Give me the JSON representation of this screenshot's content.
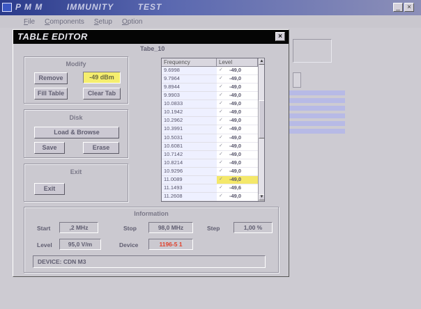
{
  "app": {
    "title": "P M M        IMMUNITY        TEST"
  },
  "menu": [
    "File",
    "Components",
    "Setup",
    "Option"
  ],
  "dialog": {
    "title": "TABLE EDITOR",
    "close": "×"
  },
  "modify": {
    "label": "Modify",
    "remove": "Remove",
    "value": "-49 dBm",
    "fill_table": "Fill Table",
    "clear_tab": "Clear Tab"
  },
  "disk": {
    "label": "Disk",
    "load_browse": "Load & Browse",
    "save": "Save",
    "erase": "Erase"
  },
  "exit": {
    "label": "Exit",
    "exit_btn": "Exit"
  },
  "table": {
    "label": "Tabe_10",
    "columns": [
      "Frequency",
      "Level"
    ],
    "selected_index": 13,
    "rows": [
      {
        "f": "9.6998",
        "l": "-49,0"
      },
      {
        "f": "9.7964",
        "l": "-49,0"
      },
      {
        "f": "9.8944",
        "l": "-49,0"
      },
      {
        "f": "9.9903",
        "l": "-49,0"
      },
      {
        "f": "10.0833",
        "l": "-49,0"
      },
      {
        "f": "10.1942",
        "l": "-49,0"
      },
      {
        "f": "10.2962",
        "l": "-49,0"
      },
      {
        "f": "10.3991",
        "l": "-49,0"
      },
      {
        "f": "10.5031",
        "l": "-49,0"
      },
      {
        "f": "10.6081",
        "l": "-49,0"
      },
      {
        "f": "10.7142",
        "l": "-49,0"
      },
      {
        "f": "10.8214",
        "l": "-49,0"
      },
      {
        "f": "10.9296",
        "l": "-49,0"
      },
      {
        "f": "11.0089",
        "l": "-49,0"
      },
      {
        "f": "11.1493",
        "l": "-49,6"
      },
      {
        "f": "11.2608",
        "l": "-49,0"
      }
    ]
  },
  "info": {
    "label": "Information",
    "start_lbl": "Start",
    "start_val": ",2 MHz",
    "stop_lbl": "Stop",
    "stop_val": "98,0 MHz",
    "step_lbl": "Step",
    "step_val": "1,00 %",
    "level_lbl": "Level",
    "level_val": "95,0 V/m",
    "device_lbl": "Device",
    "device_val": "1196-5 1",
    "status": "DEVICE: CDN M3"
  },
  "colors": {
    "device_value": "#e0402a",
    "selected_cell": "#f4e86a",
    "title_bg": "#050505"
  }
}
